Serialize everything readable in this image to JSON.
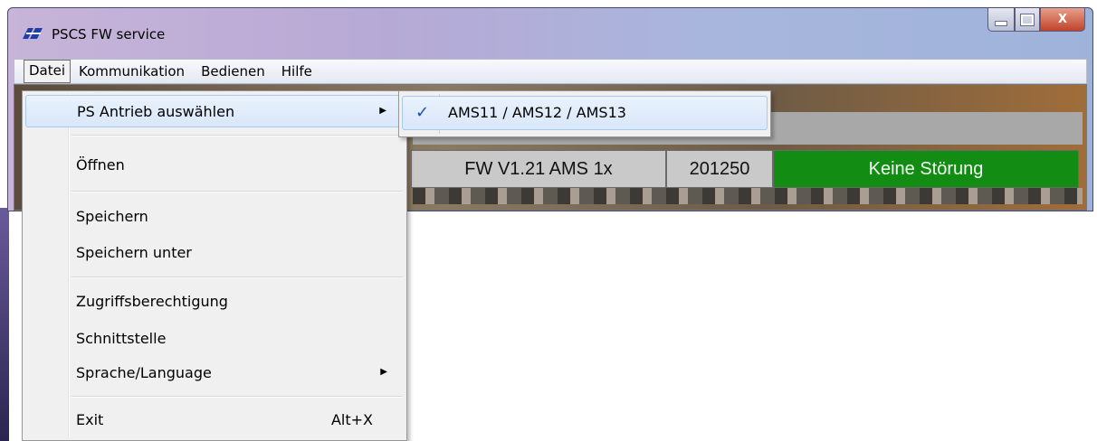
{
  "window": {
    "title": "PSCS FW service",
    "close_glyph": "X"
  },
  "menubar": {
    "items": [
      "Datei",
      "Kommunikation",
      "Bedienen",
      "Hilfe"
    ]
  },
  "status": {
    "firmware": "FW  V1.21 AMS 1x",
    "number": "201250",
    "message": "Keine Störung",
    "message_color": "#128c12"
  },
  "datei_menu": {
    "items": [
      {
        "label": "PS Antrieb auswählen",
        "submenu": true
      },
      {
        "label": "Öffnen"
      },
      {
        "label": "Speichern"
      },
      {
        "label": "Speichern unter"
      },
      {
        "label": "Zugriffsberechtigung"
      },
      {
        "label": "Schnittstelle"
      },
      {
        "label": "Sprache/Language",
        "submenu": true
      },
      {
        "label": "Exit",
        "shortcut": "Alt+X"
      }
    ],
    "arrow_glyph": "▶"
  },
  "submenu": {
    "items": [
      {
        "label": "AMS11 / AMS12 / AMS13",
        "checked": true,
        "check_glyph": "✓"
      }
    ]
  }
}
